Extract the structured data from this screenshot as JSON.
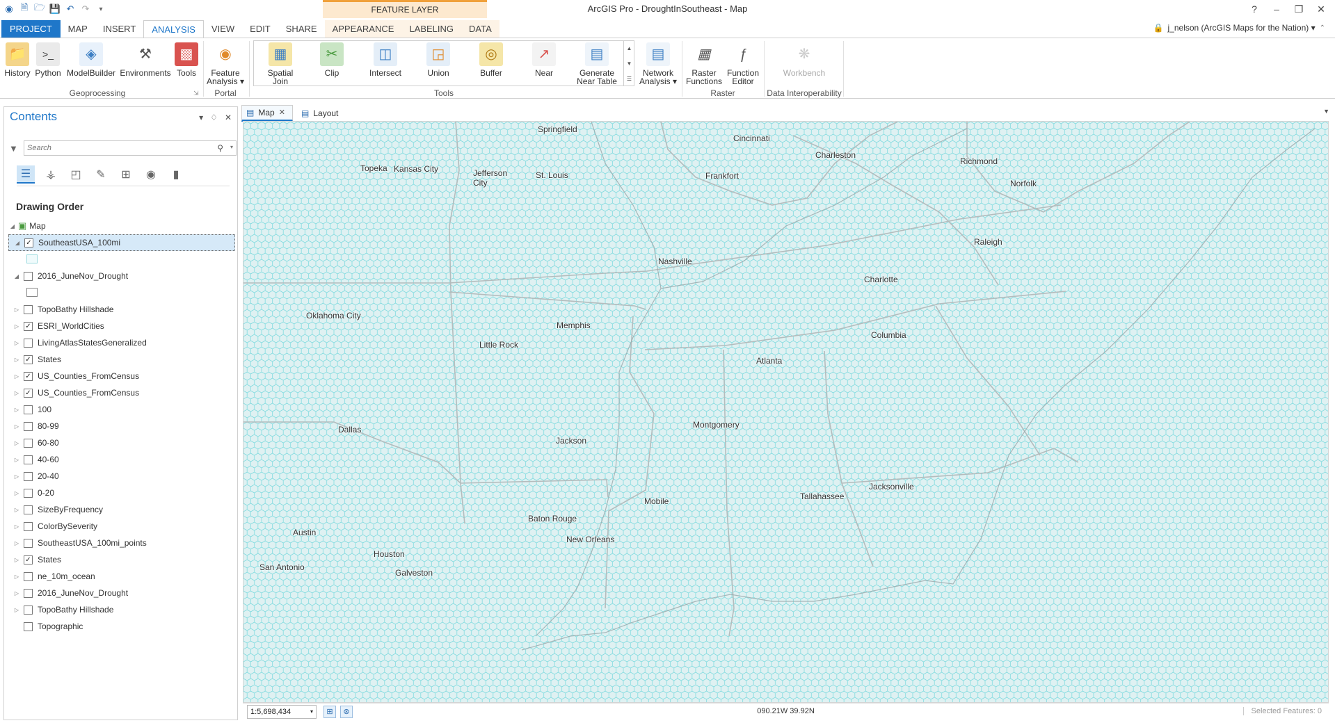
{
  "window": {
    "title": "ArcGIS Pro - DroughtInSoutheast - Map",
    "context_header": "FEATURE LAYER",
    "minimize": "–",
    "restore": "❐",
    "close": "✕"
  },
  "ribbon_tabs": [
    "PROJECT",
    "MAP",
    "INSERT",
    "ANALYSIS",
    "VIEW",
    "EDIT",
    "SHARE",
    "APPEARANCE",
    "LABELING",
    "DATA"
  ],
  "user": {
    "name": "j_nelson (ArcGIS Maps for the Nation) ▾"
  },
  "ribbon": {
    "geoprocessing": [
      "History",
      "Python",
      "ModelBuilder",
      "Environments",
      "Tools"
    ],
    "geoprocessing_label": "Geoprocessing",
    "portal_button": [
      "Feature",
      "Analysis ▾"
    ],
    "portal_label": "Portal",
    "tools": [
      [
        "Spatial",
        "Join"
      ],
      [
        "Clip",
        ""
      ],
      [
        "Intersect",
        ""
      ],
      [
        "Union",
        ""
      ],
      [
        "Buffer",
        ""
      ],
      [
        "Near",
        ""
      ],
      [
        "Generate",
        "Near Table"
      ]
    ],
    "tools_label": "Tools",
    "network": [
      "Network",
      "Analysis ▾"
    ],
    "raster_functions": [
      "Raster",
      "Functions"
    ],
    "function_editor": [
      "Function",
      "Editor"
    ],
    "raster_label": "Raster",
    "workbench": "Workbench",
    "interop_label": "Data Interoperability"
  },
  "contents": {
    "title": "Contents",
    "search_placeholder": "Search",
    "drawing_order": "Drawing Order",
    "map_name": "Map",
    "layers": [
      {
        "name": "SoutheastUSA_100mi",
        "checked": true,
        "expanded": true,
        "selected": true,
        "swatch": "cyan"
      },
      {
        "name": "2016_JuneNov_Drought",
        "checked": false,
        "expanded": true,
        "swatch": "white"
      },
      {
        "name": "TopoBathy Hillshade",
        "checked": false
      },
      {
        "name": "ESRI_WorldCities",
        "checked": true
      },
      {
        "name": "LivingAtlasStatesGeneralized",
        "checked": false
      },
      {
        "name": "States",
        "checked": true
      },
      {
        "name": "US_Counties_FromCensus",
        "checked": true
      },
      {
        "name": "US_Counties_FromCensus",
        "checked": true
      },
      {
        "name": "100",
        "checked": false
      },
      {
        "name": "80-99",
        "checked": false
      },
      {
        "name": "60-80",
        "checked": false
      },
      {
        "name": "40-60",
        "checked": false
      },
      {
        "name": "20-40",
        "checked": false
      },
      {
        "name": "0-20",
        "checked": false
      },
      {
        "name": "SizeByFrequency",
        "checked": false
      },
      {
        "name": "ColorBySeverity",
        "checked": false
      },
      {
        "name": "SoutheastUSA_100mi_points",
        "checked": false
      },
      {
        "name": "States",
        "checked": true
      },
      {
        "name": "ne_10m_ocean",
        "checked": false
      },
      {
        "name": "2016_JuneNov_Drought",
        "checked": false
      },
      {
        "name": "TopoBathy Hillshade",
        "checked": false
      },
      {
        "name": "Topographic",
        "checked": false,
        "no_expander": true
      }
    ]
  },
  "views": {
    "map_tab": "Map",
    "layout_tab": "Layout"
  },
  "map": {
    "cities": [
      {
        "name": "Springfield"
      },
      {
        "name": "Cincinnati"
      },
      {
        "name": "Topeka"
      },
      {
        "name": "Kansas City"
      },
      {
        "name": "Jefferson City"
      },
      {
        "name": "St. Louis"
      },
      {
        "name": "Charleston"
      },
      {
        "name": "Frankfort"
      },
      {
        "name": "Richmond"
      },
      {
        "name": "Norfolk"
      },
      {
        "name": "Raleigh"
      },
      {
        "name": "Nashville"
      },
      {
        "name": "Charlotte"
      },
      {
        "name": "Oklahoma City"
      },
      {
        "name": "Memphis"
      },
      {
        "name": "Little Rock"
      },
      {
        "name": "Columbia"
      },
      {
        "name": "Atlanta"
      },
      {
        "name": "Dallas"
      },
      {
        "name": "Montgomery"
      },
      {
        "name": "Jackson"
      },
      {
        "name": "Mobile"
      },
      {
        "name": "Tallahassee"
      },
      {
        "name": "Jacksonville"
      },
      {
        "name": "Baton Rouge"
      },
      {
        "name": "New Orleans"
      },
      {
        "name": "Austin"
      },
      {
        "name": "Houston"
      },
      {
        "name": "San Antonio"
      },
      {
        "name": "Galveston"
      }
    ],
    "hex_color": "#5fd3d8",
    "base_color": "#dff1f2"
  },
  "status": {
    "scale": "1:5,698,434",
    "coordinates": "090.21W 39.92N",
    "selected_features": "Selected Features: 0"
  }
}
